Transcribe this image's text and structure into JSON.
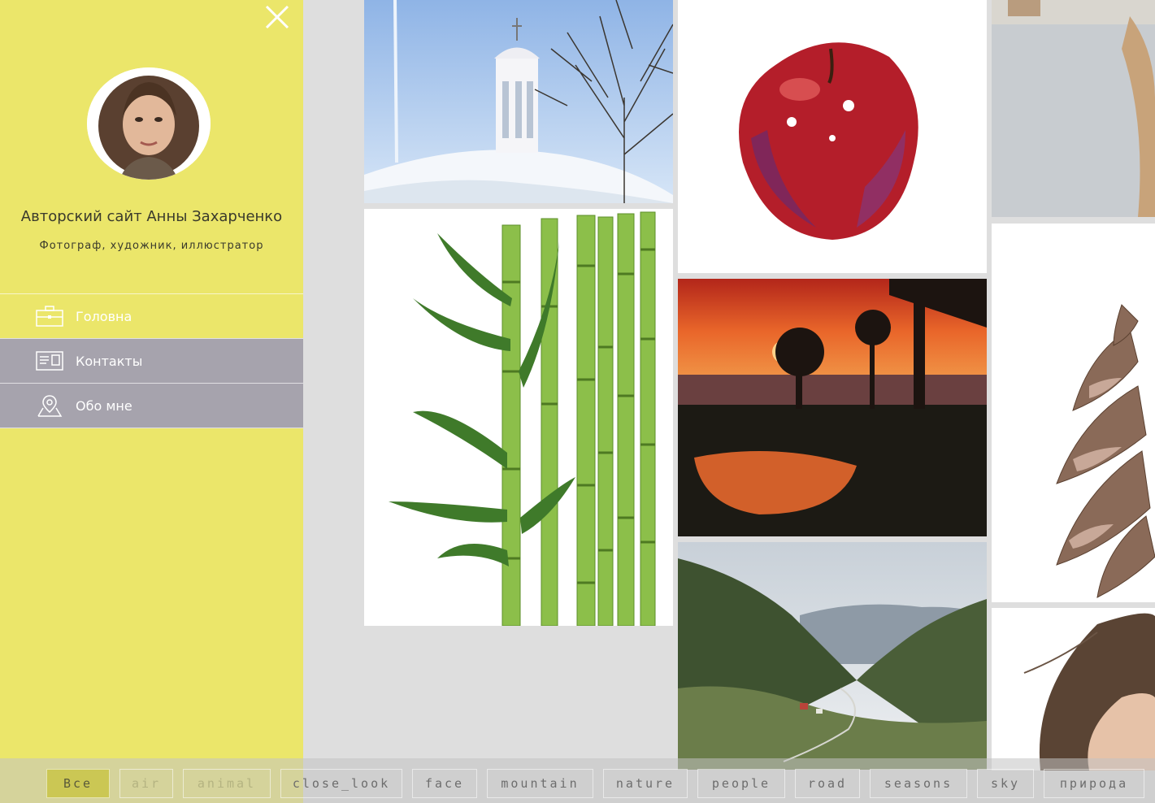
{
  "sidebar": {
    "title": "Авторский сайт Анны Захарченко",
    "subtitle": "Фотограф, художник, иллюстратор",
    "menu": [
      {
        "label": "Головна",
        "icon": "briefcase-icon"
      },
      {
        "label": "Контакты",
        "icon": "contact-card-icon"
      },
      {
        "label": "Обо мне",
        "icon": "map-pin-icon"
      }
    ]
  },
  "gallery": [
    {
      "name": "winter-rotunda"
    },
    {
      "name": "watercolor-apple"
    },
    {
      "name": "beach-sand"
    },
    {
      "name": "watercolor-bamboo"
    },
    {
      "name": "sunset-lake"
    },
    {
      "name": "watercolor-pinecone"
    },
    {
      "name": "mountain-valley"
    },
    {
      "name": "woman-hair"
    }
  ],
  "filters": [
    {
      "label": "Все",
      "active": true
    },
    {
      "label": "air"
    },
    {
      "label": "animal"
    },
    {
      "label": "close_look"
    },
    {
      "label": "face"
    },
    {
      "label": "mountain"
    },
    {
      "label": "nature"
    },
    {
      "label": "people"
    },
    {
      "label": "road"
    },
    {
      "label": "seasons"
    },
    {
      "label": "sky"
    },
    {
      "label": "природа"
    }
  ],
  "colors": {
    "sidebar_bg": "#ebe66a",
    "menu_active_bg": "#a6a3ad",
    "filter_active_bg": "#c9c448"
  }
}
